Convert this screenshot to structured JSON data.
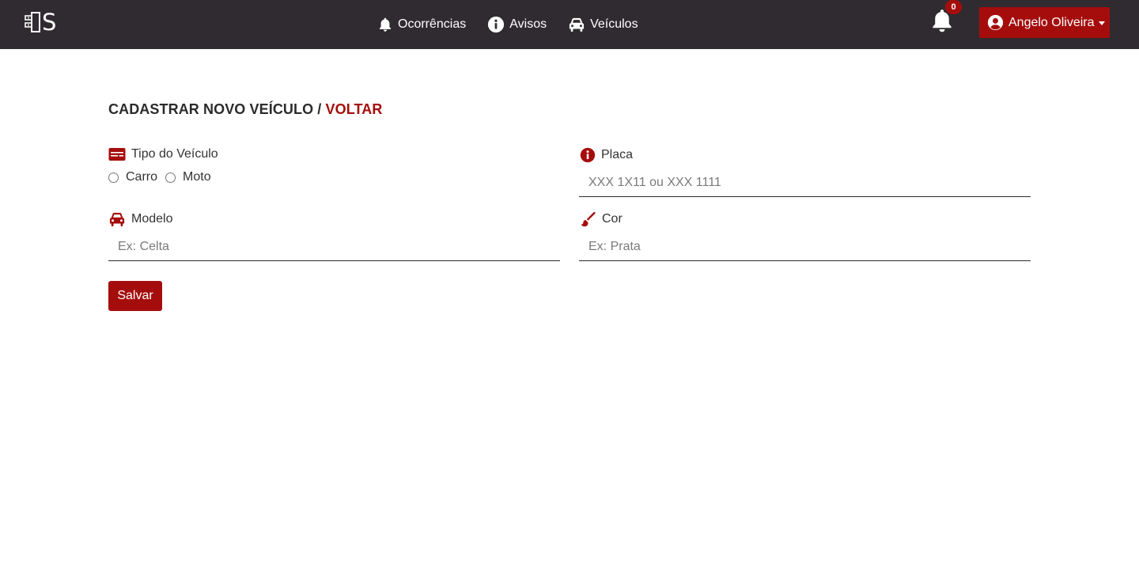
{
  "brand": {
    "logo_letter": "S"
  },
  "nav": {
    "items": [
      {
        "label": "Ocorrências",
        "icon": "bell-icon"
      },
      {
        "label": "Avisos",
        "icon": "info-circle-icon"
      },
      {
        "label": "Veículos",
        "icon": "car-icon"
      }
    ],
    "notification_count": "0",
    "user_name": "Angelo Oliveira"
  },
  "page": {
    "title": "CADASTRAR NOVO VEÍCULO / ",
    "back_link": "VOLTAR"
  },
  "form": {
    "tipo": {
      "label": "Tipo do Veículo",
      "options": [
        "Carro",
        "Moto"
      ]
    },
    "placa": {
      "label": "Placa",
      "placeholder": "XXX 1X11 ou XXX 1111",
      "value": ""
    },
    "modelo": {
      "label": "Modelo",
      "placeholder": "Ex: Celta",
      "value": ""
    },
    "cor": {
      "label": "Cor",
      "placeholder": "Ex: Prata",
      "value": ""
    },
    "submit_label": "Salvar"
  },
  "colors": {
    "navbar": "#302b30",
    "accent": "#a50d0d",
    "text": "#212529"
  }
}
